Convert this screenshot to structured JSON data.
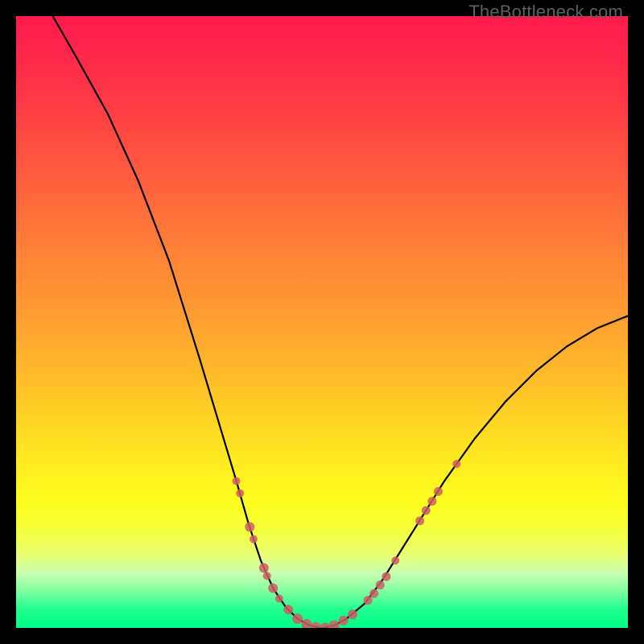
{
  "watermark": "TheBottleneck.com",
  "colors": {
    "dot": "#cc5e64",
    "curve": "#000000"
  },
  "chart_data": {
    "type": "line",
    "title": "",
    "xlabel": "",
    "ylabel": "",
    "xlim": [
      0,
      100
    ],
    "ylim": [
      0,
      100
    ],
    "grid": false,
    "legend": false,
    "series": [
      {
        "name": "bottleneck-curve",
        "x": [
          6,
          10,
          15,
          20,
          25,
          30,
          33,
          36,
          38,
          40,
          42,
          44,
          46,
          48,
          50,
          52,
          54,
          57,
          60,
          65,
          70,
          75,
          80,
          85,
          90,
          95,
          100
        ],
        "y": [
          100,
          93,
          84,
          73,
          60,
          44,
          34,
          24,
          17,
          11,
          6.5,
          3.5,
          1.5,
          0.4,
          0,
          0.4,
          1.5,
          4,
          8,
          16,
          24,
          31,
          37,
          42,
          46,
          49,
          51
        ]
      }
    ],
    "points": [
      {
        "x": 36.0,
        "y": 24.0,
        "r": 5
      },
      {
        "x": 36.6,
        "y": 22.0,
        "r": 5
      },
      {
        "x": 38.2,
        "y": 16.5,
        "r": 6
      },
      {
        "x": 38.8,
        "y": 14.5,
        "r": 5
      },
      {
        "x": 40.5,
        "y": 9.8,
        "r": 6
      },
      {
        "x": 41.0,
        "y": 8.5,
        "r": 5
      },
      {
        "x": 42.0,
        "y": 6.5,
        "r": 6
      },
      {
        "x": 43.0,
        "y": 4.8,
        "r": 5
      },
      {
        "x": 44.5,
        "y": 3.0,
        "r": 6
      },
      {
        "x": 46.0,
        "y": 1.5,
        "r": 6.5
      },
      {
        "x": 47.5,
        "y": 0.6,
        "r": 6.5
      },
      {
        "x": 49.0,
        "y": 0.1,
        "r": 6.5
      },
      {
        "x": 50.5,
        "y": 0.0,
        "r": 6.5
      },
      {
        "x": 52.0,
        "y": 0.4,
        "r": 6.5
      },
      {
        "x": 53.5,
        "y": 1.2,
        "r": 6
      },
      {
        "x": 55.0,
        "y": 2.2,
        "r": 6
      },
      {
        "x": 57.5,
        "y": 4.5,
        "r": 5.5
      },
      {
        "x": 58.5,
        "y": 5.6,
        "r": 5.5
      },
      {
        "x": 59.5,
        "y": 7.0,
        "r": 5.5
      },
      {
        "x": 60.5,
        "y": 8.4,
        "r": 5.5
      },
      {
        "x": 62.0,
        "y": 11.0,
        "r": 5
      },
      {
        "x": 66.0,
        "y": 17.5,
        "r": 5.5
      },
      {
        "x": 67.0,
        "y": 19.2,
        "r": 5.5
      },
      {
        "x": 68.0,
        "y": 20.7,
        "r": 5.5
      },
      {
        "x": 69.0,
        "y": 22.3,
        "r": 5.5
      },
      {
        "x": 72.0,
        "y": 26.8,
        "r": 5
      }
    ]
  }
}
